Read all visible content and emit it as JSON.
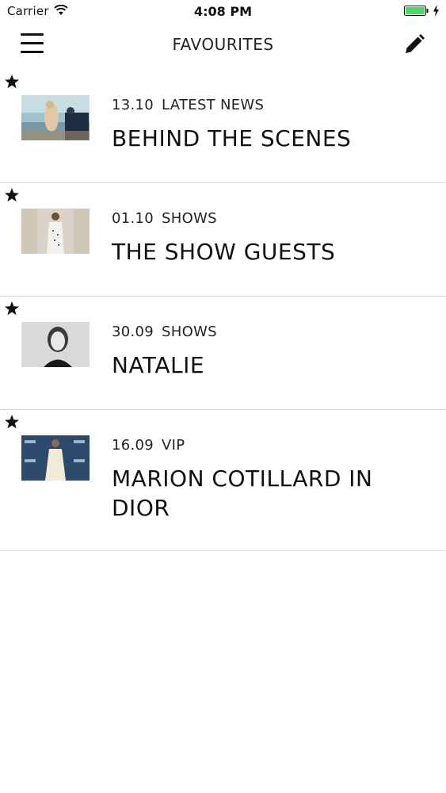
{
  "status": {
    "carrier": "Carrier",
    "time": "4:08 PM"
  },
  "header": {
    "title": "FAVOURITES",
    "menu_icon": "hamburger-icon",
    "edit_icon": "pencil-icon"
  },
  "colors": {
    "battery": "#4cd964",
    "text": "#111111",
    "divider": "#d8d8d8"
  },
  "items": [
    {
      "date": "13.10",
      "category": "LATEST NEWS",
      "title": "BEHIND THE SCENES",
      "starred": true
    },
    {
      "date": "01.10",
      "category": "SHOWS",
      "title": "THE SHOW GUESTS",
      "starred": true
    },
    {
      "date": "30.09",
      "category": "SHOWS",
      "title": "NATALIE",
      "starred": true
    },
    {
      "date": "16.09",
      "category": "VIP",
      "title": "MARION COTILLARD IN DIOR",
      "starred": true
    }
  ]
}
